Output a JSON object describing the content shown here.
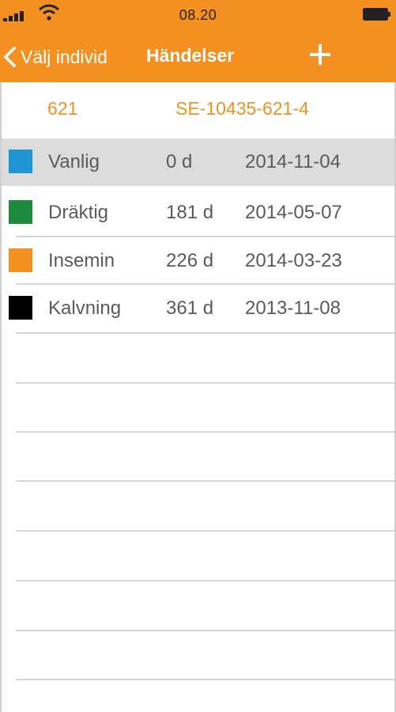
{
  "status_bar": {
    "time": "08.20",
    "signal_icon": "signal-bars-icon",
    "wifi_icon": "wifi-icon",
    "battery_icon": "battery-icon"
  },
  "nav": {
    "back_label": "Välj individ",
    "back_icon": "chevron-left-icon",
    "title": "Händelser",
    "add_icon": "plus-icon"
  },
  "animal": {
    "number": "621",
    "id_code": "SE-10435-621-4"
  },
  "events": [
    {
      "type": "Vanlig",
      "days": "0 d",
      "date": "2014-11-04",
      "color": "#1f96d3",
      "selected": true
    },
    {
      "type": "Dräktig",
      "days": "181 d",
      "date": "2014-05-07",
      "color": "#1e8a3e",
      "selected": false
    },
    {
      "type": "Insemin",
      "days": "226 d",
      "date": "2014-03-23",
      "color": "#f39020",
      "selected": false
    },
    {
      "type": "Kalvning",
      "days": "361 d",
      "date": "2013-11-08",
      "color": "#000000",
      "selected": false
    }
  ],
  "colors": {
    "accent": "#f39020",
    "selected_row": "#dcdcdc",
    "text": "#5a5a5a"
  }
}
